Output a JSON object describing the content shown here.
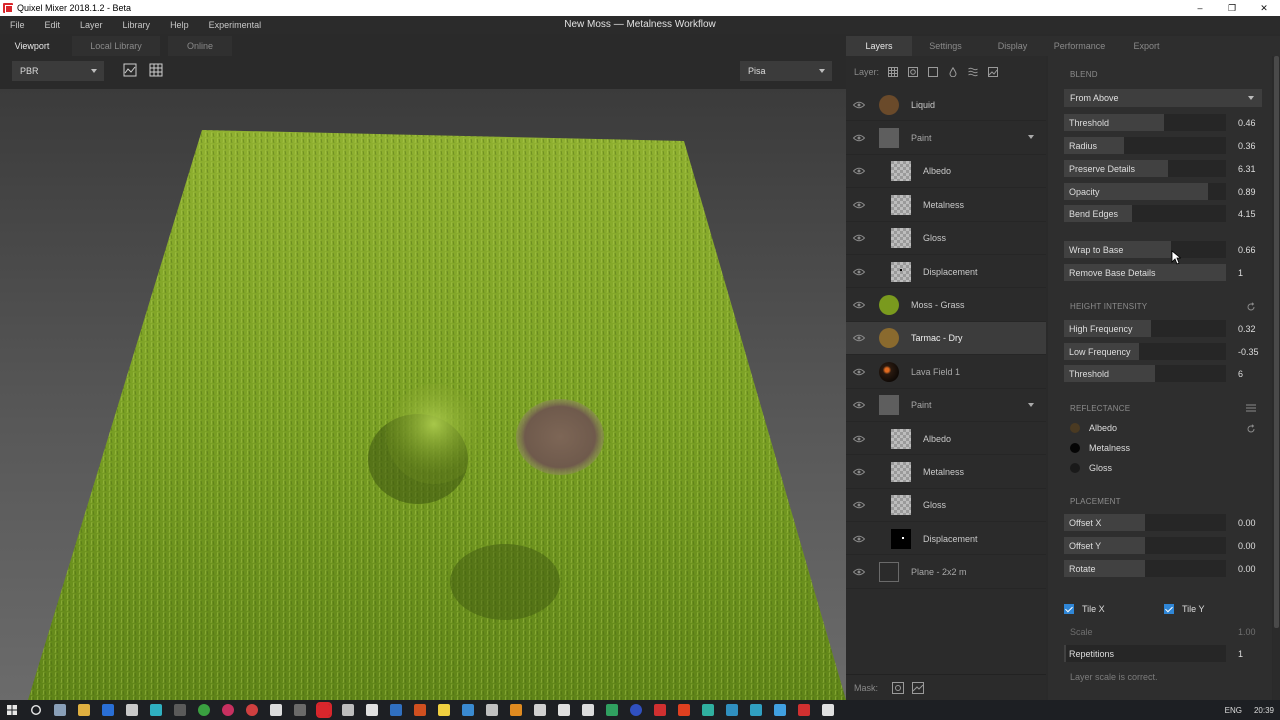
{
  "window": {
    "app_title": "Quixel Mixer 2018.1.2 - Beta",
    "doc_title": "New Moss — Metalness Workflow",
    "controls": [
      "–",
      "❐",
      "✕"
    ]
  },
  "menu": [
    "File",
    "Edit",
    "Layer",
    "Library",
    "Help",
    "Experimental"
  ],
  "viewport": {
    "tabs": [
      "Viewport",
      "Local Library",
      "Online"
    ],
    "active_tab": "Viewport",
    "shading_mode": "PBR",
    "environment": "Pisa",
    "toolbar_icons": [
      "channel-view-icon",
      "grid-icon"
    ]
  },
  "panel_tabs": [
    "Layers",
    "Settings",
    "Display",
    "Performance",
    "Export"
  ],
  "layers": {
    "toolbar_label": "Layer:",
    "toolbar_icons": [
      "paint-layer-icon",
      "solid-layer-icon",
      "fill-layer-icon",
      "drop-icon",
      "pattern-icon",
      "image-layer-icon"
    ],
    "items": [
      {
        "name": "Liquid",
        "kind": "material",
        "color": "#6a4a2a",
        "child": false
      },
      {
        "name": "Paint",
        "kind": "group",
        "color": "#8a8a8a",
        "child": false,
        "expanded": true
      },
      {
        "name": "Albedo",
        "kind": "checker",
        "child": true
      },
      {
        "name": "Metalness",
        "kind": "checker",
        "child": true
      },
      {
        "name": "Gloss",
        "kind": "checker",
        "child": true
      },
      {
        "name": "Displacement",
        "kind": "dot",
        "child": true
      },
      {
        "name": "Moss - Grass",
        "kind": "material",
        "color": "#7a9a1e",
        "child": false
      },
      {
        "name": "Tarmac - Dry",
        "kind": "material",
        "color": "#8a6a2e",
        "child": false,
        "selected": true
      },
      {
        "name": "Lava Field 1",
        "kind": "lava",
        "color": "#2a1a10",
        "child": false
      },
      {
        "name": "Paint",
        "kind": "group",
        "color": "#8a8a8a",
        "child": false,
        "expanded": true
      },
      {
        "name": "Albedo",
        "kind": "checker",
        "child": true
      },
      {
        "name": "Metalness",
        "kind": "checker",
        "child": true
      },
      {
        "name": "Gloss",
        "kind": "checker",
        "child": true
      },
      {
        "name": "Displacement",
        "kind": "black",
        "child": true
      },
      {
        "name": "Plane - 2x2 m",
        "kind": "plane",
        "child": false
      }
    ],
    "mask_label": "Mask:"
  },
  "blend": {
    "heading": "BLEND",
    "mode": "From Above",
    "sliders": [
      {
        "label": "Threshold",
        "value": "0.46",
        "fill": 0.62
      },
      {
        "label": "Radius",
        "value": "0.36",
        "fill": 0.37
      },
      {
        "label": "Preserve Details",
        "value": "6.31",
        "fill": 0.64
      },
      {
        "label": "Opacity",
        "value": "0.89",
        "fill": 0.89
      },
      {
        "label": "Bend Edges",
        "value": "4.15",
        "fill": 0.42
      },
      {
        "label": "Wrap to Base",
        "value": "0.66",
        "fill": 0.66
      },
      {
        "label": "Remove Base Details",
        "value": "1",
        "fill": 1.0
      }
    ]
  },
  "height_intensity": {
    "heading": "HEIGHT INTENSITY",
    "sliders": [
      {
        "label": "High Frequency",
        "value": "0.32",
        "fill": 0.54
      },
      {
        "label": "Low Frequency",
        "value": "-0.35",
        "fill": 0.46
      },
      {
        "label": "Threshold",
        "value": "6",
        "fill": 0.56
      }
    ]
  },
  "reflectance": {
    "heading": "REFLECTANCE",
    "items": [
      {
        "label": "Albedo",
        "color": "#4a3a22"
      },
      {
        "label": "Metalness",
        "color": "#050505"
      },
      {
        "label": "Gloss",
        "color": "#1a1a1a"
      }
    ]
  },
  "placement": {
    "heading": "PLACEMENT",
    "sliders": [
      {
        "label": "Offset X",
        "value": "0.00",
        "fill": 0.5
      },
      {
        "label": "Offset Y",
        "value": "0.00",
        "fill": 0.5
      },
      {
        "label": "Rotate",
        "value": "0.00",
        "fill": 0.5
      }
    ],
    "tile_x": "Tile X",
    "tile_y": "Tile Y",
    "scale_label": "Scale",
    "scale_value": "1.00",
    "repetitions_label": "Repetitions",
    "repetitions_value": "1",
    "note": "Layer scale is correct."
  },
  "taskbar": {
    "language": "ENG",
    "time": "20:39"
  },
  "colors": {
    "accent": "#2f86d6",
    "brand": "#d9262c",
    "grass_light": "#9cc23a",
    "grass_dark": "#4e6e16",
    "dirt": "#7d6656"
  }
}
